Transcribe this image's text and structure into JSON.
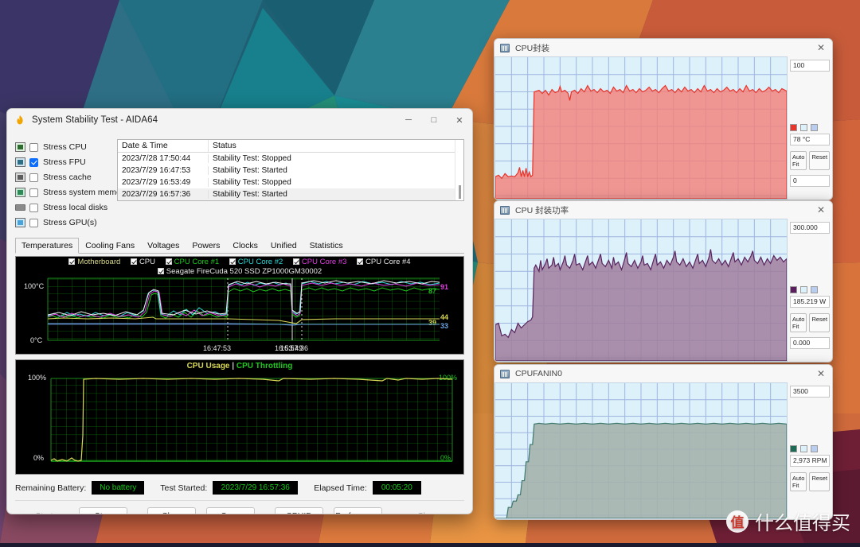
{
  "window": {
    "title": "System Stability Test - AIDA64",
    "app_icon": "aida64-icon",
    "minimize": "─",
    "maximize": "□",
    "close": "✕"
  },
  "stress_options": [
    {
      "label": "Stress CPU",
      "checked": false,
      "icon": "cpu-icon"
    },
    {
      "label": "Stress FPU",
      "checked": true,
      "icon": "fpu-icon"
    },
    {
      "label": "Stress cache",
      "checked": false,
      "icon": "cache-icon"
    },
    {
      "label": "Stress system memory",
      "checked": false,
      "icon": "memory-icon"
    },
    {
      "label": "Stress local disks",
      "checked": false,
      "icon": "disk-icon"
    },
    {
      "label": "Stress GPU(s)",
      "checked": false,
      "icon": "gpu-icon"
    }
  ],
  "log": {
    "columns": [
      "Date & Time",
      "Status"
    ],
    "rows": [
      {
        "datetime": "2023/7/28 17:50:44",
        "status": "Stability Test: Stopped"
      },
      {
        "datetime": "2023/7/29 16:47:53",
        "status": "Stability Test: Started"
      },
      {
        "datetime": "2023/7/29 16:53:49",
        "status": "Stability Test: Stopped"
      },
      {
        "datetime": "2023/7/29 16:57:36",
        "status": "Stability Test: Started"
      }
    ]
  },
  "tabs": [
    {
      "label": "Temperatures",
      "active": true
    },
    {
      "label": "Cooling Fans",
      "active": false
    },
    {
      "label": "Voltages",
      "active": false
    },
    {
      "label": "Powers",
      "active": false
    },
    {
      "label": "Clocks",
      "active": false
    },
    {
      "label": "Unified",
      "active": false
    },
    {
      "label": "Statistics",
      "active": false
    }
  ],
  "temp_chart": {
    "legend_row1": [
      {
        "label": "Motherboard",
        "color": "#d9d98a"
      },
      {
        "label": "CPU",
        "color": "#e8e8e8"
      },
      {
        "label": "CPU Core #1",
        "color": "#1ec81e"
      },
      {
        "label": "CPU Core #2",
        "color": "#2fd9d9"
      },
      {
        "label": "CPU Core #3",
        "color": "#e040e0"
      },
      {
        "label": "CPU Core #4",
        "color": "#e8e8e8"
      }
    ],
    "legend_row2": [
      {
        "label": "Seagate FireCuda 520 SSD ZP1000GM30002",
        "color": "#e8e8e8"
      }
    ],
    "y_top": "100°C",
    "y_bottom": "0°C",
    "x_ticks": [
      "16:47:53",
      "16:53:49",
      "16:57:36"
    ],
    "value_labels": [
      {
        "text": "87",
        "color": "#1ec81e"
      },
      {
        "text": "91",
        "color": "#e040e0"
      },
      {
        "text": "39",
        "color": "#d9d955"
      },
      {
        "text": "44",
        "color": "#d9d955"
      },
      {
        "text": "33",
        "color": "#6ea8e8"
      }
    ]
  },
  "usage_chart": {
    "title_left": "CPU Usage",
    "title_sep": "|",
    "title_right": "CPU Throttling",
    "title_left_color": "#d9d955",
    "title_right_color": "#1ec81e",
    "y_top_left": "100%",
    "y_bottom_left": "0%",
    "y_top_right": "100%",
    "y_bottom_right": "0%"
  },
  "status": {
    "battery_label": "Remaining Battery:",
    "battery_value": "No battery",
    "started_label": "Test Started:",
    "started_value": "2023/7/29 16:57:36",
    "elapsed_label": "Elapsed Time:",
    "elapsed_value": "00:05:20"
  },
  "buttons": [
    {
      "label": "Start",
      "disabled": true,
      "name": "start-button"
    },
    {
      "label": "Stop",
      "disabled": false,
      "name": "stop-button"
    },
    {
      "label": "Clear",
      "disabled": false,
      "name": "clear-button"
    },
    {
      "label": "Save",
      "disabled": false,
      "name": "save-button"
    },
    {
      "label": "CPUID",
      "disabled": false,
      "name": "cpuid-button"
    },
    {
      "label": "Preferences",
      "disabled": false,
      "name": "preferences-button"
    }
  ],
  "close_button": {
    "label": "Close",
    "disabled": true
  },
  "panels": [
    {
      "title": "CPU封装",
      "max": "100",
      "min": "0",
      "current": "78 °C",
      "swatch": "#e8342a",
      "line_color": "#e8342a",
      "fill_color": "rgba(244,128,120,0.82)",
      "autofit": "Auto Fit",
      "reset": "Reset"
    },
    {
      "title": "CPU 封装功率",
      "max": "300.000",
      "min": "0.000",
      "current": "185.219 W",
      "swatch": "#5a1e5e",
      "line_color": "#5a2560",
      "fill_color": "rgba(160,126,156,0.85)",
      "autofit": "Auto Fit",
      "reset": "Reset"
    },
    {
      "title": "CPUFANIN0",
      "max": "3500",
      "min": "",
      "current": "2,973 RPM",
      "swatch": "#1d6b55",
      "line_color": "#3f7a6e",
      "fill_color": "rgba(164,176,171,0.88)",
      "autofit": "Auto Fit",
      "reset": "Reset"
    }
  ],
  "watermark": {
    "badge": "值",
    "text": "什么值得买"
  },
  "chart_data": [
    {
      "type": "line",
      "title": "Temperatures",
      "ylabel": "°C",
      "ylim": [
        0,
        100
      ],
      "x_ticks": [
        "16:47:53",
        "16:53:49",
        "16:57:36"
      ],
      "series": [
        {
          "name": "Motherboard",
          "color": "#d9d98a",
          "final": 44
        },
        {
          "name": "CPU",
          "color": "#e8e8e8",
          "final": 91
        },
        {
          "name": "CPU Core #1",
          "color": "#1ec81e",
          "final": 87
        },
        {
          "name": "CPU Core #2",
          "color": "#2fd9d9",
          "final": 91
        },
        {
          "name": "CPU Core #3",
          "color": "#e040e0",
          "final": 90
        },
        {
          "name": "CPU Core #4",
          "color": "#e8e8e8",
          "final": 89
        },
        {
          "name": "Seagate FireCuda 520 SSD ZP1000GM30002",
          "color": "#6ea8e8",
          "final": 33
        }
      ]
    },
    {
      "type": "line",
      "title": "CPU Usage | CPU Throttling",
      "ylabel": "%",
      "ylim": [
        0,
        100
      ],
      "series": [
        {
          "name": "CPU Usage",
          "color": "#d9d955",
          "final": 100
        },
        {
          "name": "CPU Throttling",
          "color": "#1ec81e",
          "final": 0
        }
      ]
    },
    {
      "type": "area",
      "title": "CPU封装",
      "ylabel": "°C",
      "ylim": [
        0,
        100
      ],
      "series": [
        {
          "name": "CPU封装",
          "color": "#e8342a",
          "final": 78
        }
      ]
    },
    {
      "type": "area",
      "title": "CPU 封装功率",
      "ylabel": "W",
      "ylim": [
        0,
        300
      ],
      "series": [
        {
          "name": "CPU 封装功率",
          "color": "#5a2560",
          "final": 185.219
        }
      ]
    },
    {
      "type": "area",
      "title": "CPUFANIN0",
      "ylabel": "RPM",
      "ylim": [
        0,
        3500
      ],
      "series": [
        {
          "name": "CPUFANIN0",
          "color": "#3f7a6e",
          "final": 2973
        }
      ]
    }
  ]
}
